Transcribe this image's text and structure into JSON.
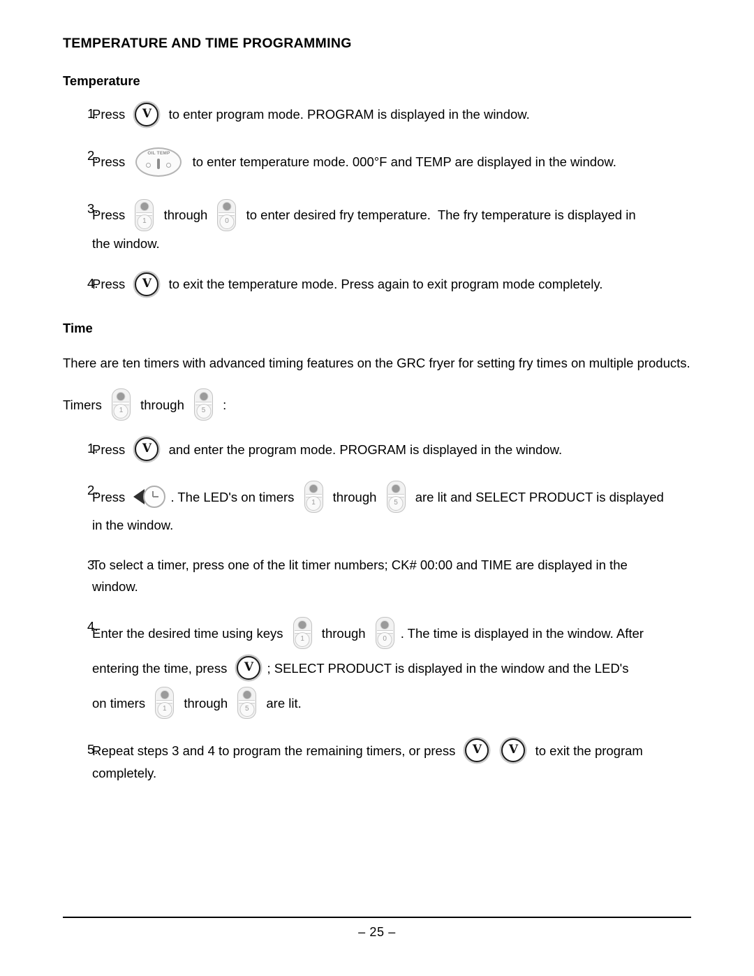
{
  "document": {
    "title": "TEMPERATURE AND TIME PROGRAMMING",
    "page_number": "– 25 –"
  },
  "icons": {
    "program_button": {
      "name": "program-button",
      "glyph": "V"
    },
    "oil_temp_button": {
      "name": "oil-temp-button",
      "label": "OIL TEMP"
    },
    "clock_button": {
      "name": "timer-clock-button"
    },
    "key_1": {
      "name": "keypad-key-1",
      "digit": "1"
    },
    "key_0": {
      "name": "keypad-key-0",
      "digit": "0"
    },
    "timer_key_1": {
      "name": "timer-key-1",
      "digit": "1"
    },
    "timer_key_5": {
      "name": "timer-key-5",
      "digit": "5"
    }
  },
  "temperature": {
    "heading": "Temperature",
    "steps": [
      {
        "number": "1.",
        "seg1": "Press ",
        "seg2": " to enter program mode. PROGRAM is displayed in the window."
      },
      {
        "number": "2.",
        "seg1": "Press ",
        "seg2": " to enter temperature mode. 000°F and TEMP are displayed in the window."
      },
      {
        "number": "3.",
        "seg1": "Press ",
        "seg2": " through ",
        "seg3": " to enter desired fry temperature.  The fry temperature is displayed in",
        "seg4": "the window."
      },
      {
        "number": "4.",
        "seg1": "Press ",
        "seg2": " to exit the temperature mode. Press again to exit program mode completely."
      }
    ]
  },
  "time": {
    "heading": "Time",
    "intro": "There are ten timers with advanced timing features on the GRC fryer for setting fry times on multiple products.",
    "timers_line": {
      "seg1": "Timers ",
      "seg2": " through ",
      "seg3": " :"
    },
    "steps": [
      {
        "number": "1.",
        "seg1": "Press ",
        "seg2": " and enter the program mode. PROGRAM is displayed in the window."
      },
      {
        "number": "2.",
        "seg1": "Press ",
        "seg2": ". The LED's on timers ",
        "seg3": " through ",
        "seg4": " are lit and SELECT PRODUCT is displayed",
        "seg5": "in the window."
      },
      {
        "number": "3.",
        "seg1": "To select a timer, press one of the lit timer numbers; CK# 00:00 and TIME are displayed in the",
        "seg2": "window."
      },
      {
        "number": "4.",
        "seg1": "Enter the desired time using keys ",
        "seg2": " through ",
        "seg3": ". The time is displayed in the window. After",
        "seg4": "entering the time, press ",
        "seg5": "; SELECT PRODUCT is displayed in the window and the LED's",
        "seg6": "on timers ",
        "seg7": " through ",
        "seg8": " are lit."
      },
      {
        "number": "5.",
        "seg1": "Repeat steps 3 and 4 to program the remaining timers, or press ",
        "seg2": " to exit the program",
        "seg3": "completely."
      }
    ]
  }
}
